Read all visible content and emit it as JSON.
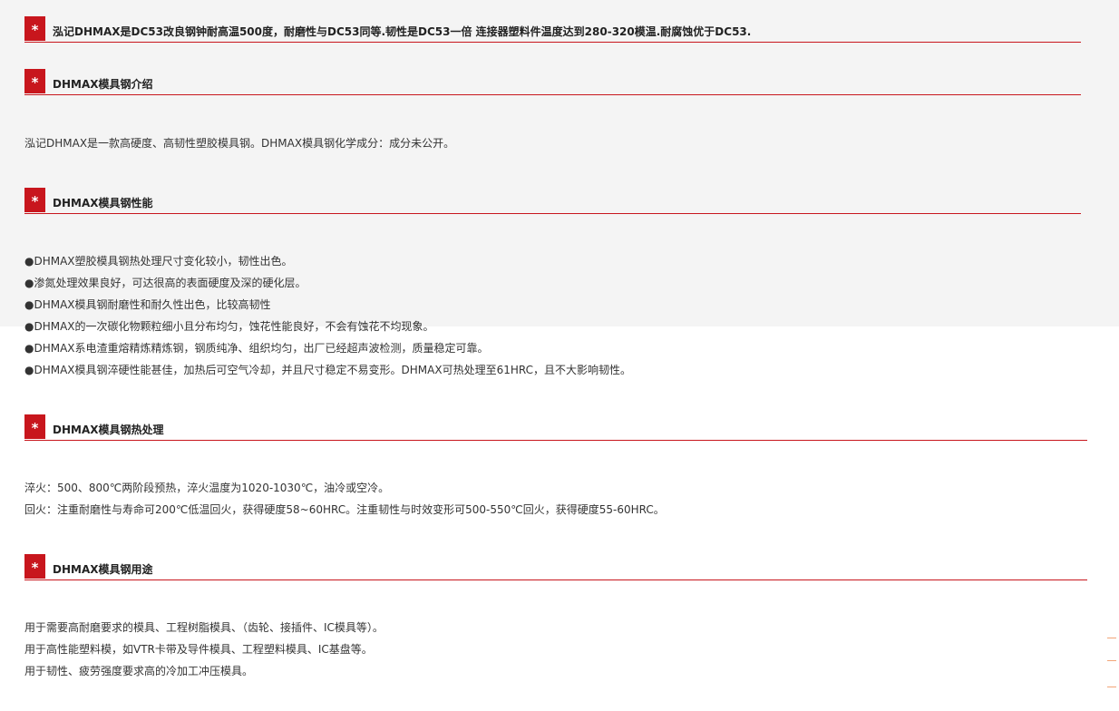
{
  "marker": "*",
  "sections": {
    "intro_headline": "泓记DHMAX是DC53改良钢钟耐高温500度，耐磨性与DC53同等.韧性是DC53一倍 连接器塑料件温度达到280-320模温.耐腐蚀优于DC53.",
    "intro": {
      "title": "DHMAX模具钢介绍",
      "text": "泓记DHMAX是一款高硬度、高韧性塑胶模具钢。DHMAX模具钢化学成分：成分未公开。"
    },
    "performance": {
      "title": "DHMAX模具钢性能",
      "items": [
        "●DHMAX塑胶模具钢热处理尺寸变化较小，韧性出色。",
        "●渗氮处理效果良好，可达很高的表面硬度及深的硬化层。",
        "●DHMAX模具钢耐磨性和耐久性出色，比较高韧性",
        "●DHMAX的一次碳化物颗粒细小且分布均匀，蚀花性能良好，不会有蚀花不均现象。",
        "●DHMAX系电渣重熔精炼精炼钢，钢质纯净、组织均匀，出厂已经超声波检测，质量稳定可靠。",
        "●DHMAX模具钢淬硬性能甚佳，加热后可空气冷却，并且尺寸稳定不易变形。DHMAX可热处理至61HRC，且不大影响韧性。"
      ]
    },
    "heat_treatment": {
      "title": "DHMAX模具钢热处理",
      "items": [
        "淬火：500、800℃两阶段预热，淬火温度为1020-1030℃，油冷或空冷。",
        "回火：注重耐磨性与寿命可200℃低温回火，获得硬度58~60HRC。注重韧性与时效变形可500-550℃回火，获得硬度55-60HRC。"
      ]
    },
    "applications": {
      "title": "DHMAX模具钢用途",
      "items": [
        "用于需要高耐磨要求的模具、工程树脂模具、（齿轮、接插件、IC模具等）。",
        "用于高性能塑料模，如VTR卡带及导件模具、工程塑料模具、IC基盘等。",
        "用于韧性、疲劳强度要求高的冷加工冲压模具。"
      ]
    }
  },
  "colors": {
    "accent": "#c8161d",
    "upper_background": "#f4f4f4",
    "text": "#333333"
  }
}
